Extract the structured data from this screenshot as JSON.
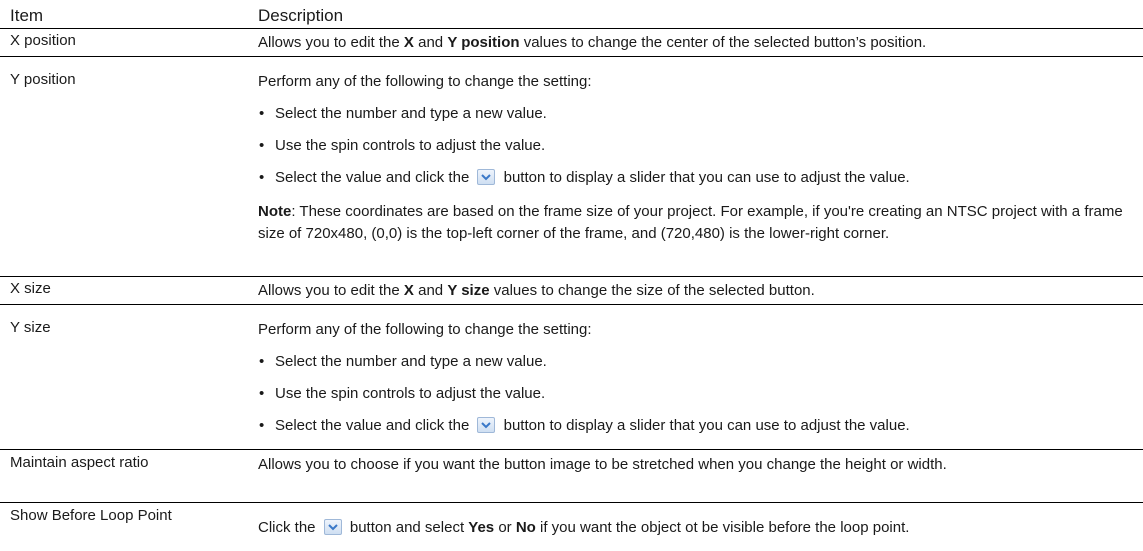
{
  "header": {
    "col_item": "Item",
    "col_description": "Description"
  },
  "rows": [
    {
      "item": "X position",
      "desc_a": "Allows you to edit the ",
      "desc_b": "X",
      "desc_c": " and ",
      "desc_d": "Y position",
      "desc_e": " values to change the center of the selected button’s position."
    },
    {
      "item": "Y position",
      "intro": "Perform any of the following to change the setting:",
      "bullets": [
        "Select the number and type a new value.",
        "Use the spin controls to adjust the value."
      ],
      "bullet3_a": "Select the value and click the ",
      "bullet3_b": " button to display a slider that you can use to adjust the value.",
      "note_label": "Note",
      "note_text": ": These coordinates are based on the frame size of your project. For example, if you're creating an NTSC project with a frame size of 720x480, (0,0) is the top-left corner of the frame, and (720,480) is the lower-right corner."
    },
    {
      "item": "X size",
      "desc_a": "Allows you to edit the ",
      "desc_b": "X",
      "desc_c": " and ",
      "desc_d": "Y size",
      "desc_e": " values to change the size of the selected button."
    },
    {
      "item": "Y size",
      "intro": "Perform any of the following to change the setting:",
      "bullets": [
        "Select the number and type a new value.",
        "Use the spin controls to adjust the value."
      ],
      "bullet3_a": "Select the value and click the ",
      "bullet3_b": " button to display a slider that you can use to adjust the value."
    },
    {
      "item": "Maintain aspect ratio",
      "desc": "Allows you to choose if you want the button image to be stretched when you change the height or width."
    },
    {
      "item": "Show Before Loop Point",
      "desc_a": "Click the ",
      "desc_b": " button and select ",
      "desc_c": "Yes",
      "desc_d": " or ",
      "desc_e": "No",
      "desc_f": " if you want the object ot be visible before the loop point."
    }
  ],
  "bullet_char": "•",
  "icons": {
    "dropdown": "chevron-down-icon"
  },
  "colors": {
    "icon_chevron": "#3a78c8"
  }
}
